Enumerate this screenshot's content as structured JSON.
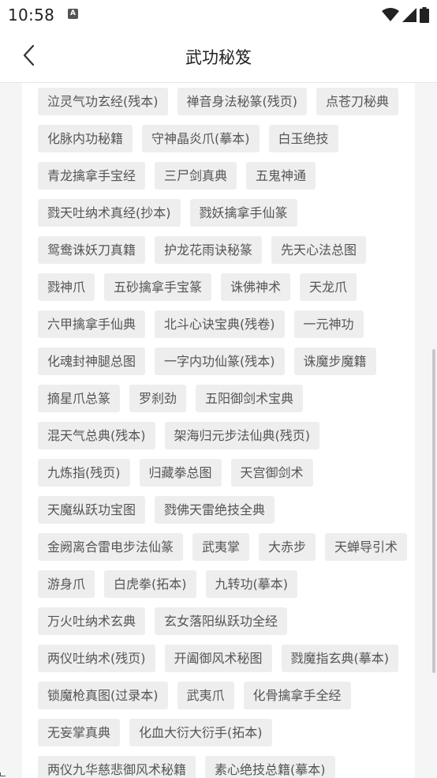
{
  "status_bar": {
    "time": "10:58",
    "notification_icon": "A",
    "icons": [
      "wifi-icon",
      "signal-icon",
      "battery-icon"
    ]
  },
  "app_bar": {
    "title": "武功秘笈",
    "back_icon": "chevron-left-icon"
  },
  "tags": [
    "泣灵气功玄经(残本)",
    "禅音身法秘篆(残页)",
    "点苍刀秘典",
    "化脉内功秘籍",
    "守神晶炎爪(摹本)",
    "白玉绝技",
    "青龙擒拿手宝经",
    "三尸剑真典",
    "五鬼神通",
    "戮天吐纳术真经(抄本)",
    "戮妖擒拿手仙篆",
    "鸳鸯诛妖刀真籍",
    "护龙花雨诀秘篆",
    "先天心法总图",
    "戮神爪",
    "五砂擒拿手宝篆",
    "诛佛神术",
    "天龙爪",
    "六甲擒拿手仙典",
    "北斗心诀宝典(残卷)",
    "一元神功",
    "化魂封神腿总图",
    "一字内功仙篆(残本)",
    "诛魔步魔籍",
    "摘星爪总篆",
    "罗刹劲",
    "五阳御剑术宝典",
    "混天气总典(残本)",
    "架海归元步法仙典(残页)",
    "九炼指(残页)",
    "归藏拳总图",
    "天宫御剑术",
    "天魔纵跃功宝图",
    "戮佛天雷绝技全典",
    "金阙离合雷电步法仙篆",
    "武夷掌",
    "大赤步",
    "天蝉导引术",
    "游身爪",
    "白虎拳(拓本)",
    "九转功(摹本)",
    "万火吐纳术玄典",
    "玄女落阳纵跃功全经",
    "两仪吐纳术(残页)",
    "开阖御风术秘图",
    "戮魔指玄典(摹本)",
    "锁魔枪真图(过录本)",
    "武夷爪",
    "化骨擒拿手全经",
    "无妄掌真典",
    "化血大衍大衍手(拓本)",
    "两仪九华慈悲御风术秘籍",
    "素心绝技总籍(摹本)"
  ]
}
